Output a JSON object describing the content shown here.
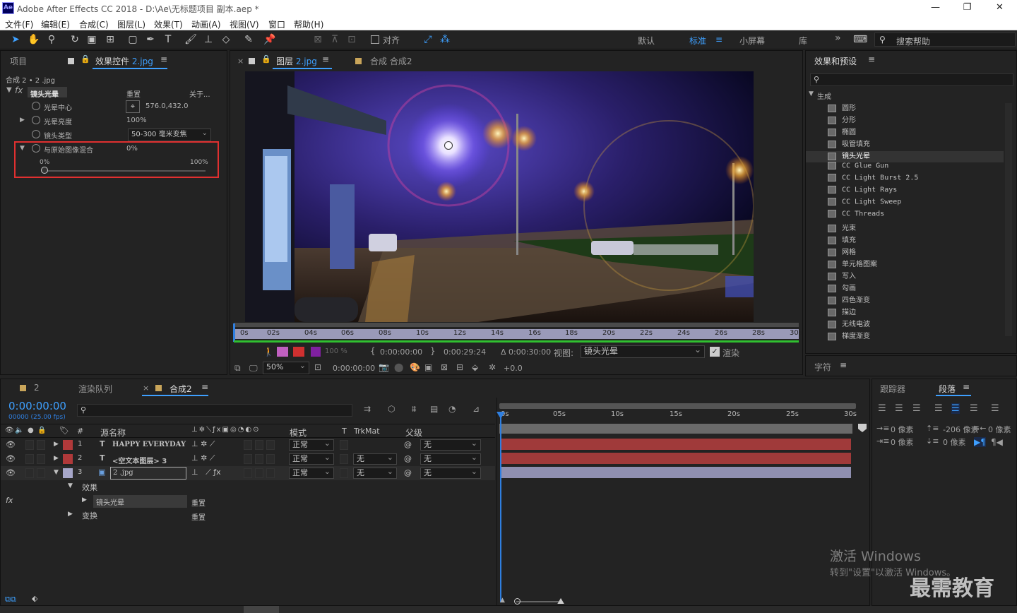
{
  "window": {
    "app_icon": "Ae",
    "title": "Adobe After Effects CC 2018 - D:\\Ae\\无标题项目 副本.aep *"
  },
  "menu": [
    "文件(F)",
    "编辑(E)",
    "合成(C)",
    "图层(L)",
    "效果(T)",
    "动画(A)",
    "视图(V)",
    "窗口",
    "帮助(H)"
  ],
  "toolbar": {
    "snap_label": "对齐",
    "workspaces": [
      "默认",
      "标准",
      "小屏幕",
      "库"
    ],
    "active_workspace": "标准",
    "search_placeholder": "搜索帮助"
  },
  "left_panel": {
    "tab_project": "项目",
    "tab_effect_controls": "效果控件",
    "effect_layer": "2.jpg",
    "breadcrumb": "合成 2 • 2 .jpg",
    "effect_name": "镜头光晕",
    "reset": "重置",
    "about": "关于...",
    "props": [
      {
        "name": "光晕中心",
        "value": "576.0,432.0"
      },
      {
        "name": "光晕亮度",
        "value": "100%"
      },
      {
        "name": "镜头类型",
        "value": "50-300 毫米变焦"
      },
      {
        "name": "与原始图像混合",
        "value": "0%"
      }
    ],
    "slider_min": "0%",
    "slider_max": "100%",
    "slider_value": 0
  },
  "viewer": {
    "tab_layer": "图层",
    "layer_name": "2.jpg",
    "tab_comp": "合成 合成2",
    "ruler": [
      "0s",
      "02s",
      "04s",
      "06s",
      "08s",
      "10s",
      "12s",
      "14s",
      "16s",
      "18s",
      "20s",
      "22s",
      "24s",
      "26s",
      "28s",
      "30s"
    ],
    "opacity": "100 %",
    "in_time": "0:00:00:00",
    "out_time": "0:00:29:24",
    "duration": "Δ 0:00:30:00",
    "view_label": "视图:",
    "view_value": "镜头光晕",
    "render_label": "渲染",
    "zoom": "50%",
    "current_time": "0:00:00:00",
    "exposure": "+0.0"
  },
  "effects_panel": {
    "title": "效果和预设",
    "category": "生成",
    "items": [
      "圆形",
      "分形",
      "椭圆",
      "吸管填充",
      "镜头光晕",
      "CC Glue Gun",
      "CC Light Burst 2.5",
      "CC Light Rays",
      "CC Light Sweep",
      "CC Threads",
      "光束",
      "填充",
      "网格",
      "单元格图案",
      "写入",
      "勾画",
      "四色渐变",
      "描边",
      "无线电波",
      "梯度渐变"
    ],
    "selected": "镜头光晕"
  },
  "char_panel": {
    "title": "字符"
  },
  "para_panel": {
    "tab_tracker": "跟踪器",
    "tab_paragraph": "段落",
    "indent_left": "0 像素",
    "space_before": "-206 像素",
    "indent_right": "0 像素",
    "first_line": "0 像素",
    "space_after": "0 像素"
  },
  "timeline": {
    "tab_comp_number": "2",
    "tab_render_queue": "渲染队列",
    "tab_comp": "合成2",
    "timecode": "0:00:00:00",
    "fps": "00000 (25.00 fps)",
    "columns": {
      "source_name": "源名称",
      "mode": "模式",
      "t": "T",
      "trkmat": "TrkMat",
      "parent": "父级"
    },
    "layers": [
      {
        "num": "1",
        "type": "T",
        "name": "HAPPY EVERYDAY",
        "color": "#b0393a",
        "mode": "正常",
        "trkmat": "",
        "parent": "无"
      },
      {
        "num": "2",
        "type": "T",
        "name": "<空文本图层> 3",
        "color": "#b0393a",
        "mode": "正常",
        "trkmat": "无",
        "parent": "无"
      },
      {
        "num": "3",
        "type": "img",
        "name": "2 .jpg",
        "color": "#a7a7c9",
        "mode": "正常",
        "trkmat": "无",
        "parent": "无"
      }
    ],
    "effects_label": "效果",
    "effect_item": "镜头光晕",
    "reset": "重置",
    "transform_label": "变换",
    "ruler": [
      "0s",
      "05s",
      "10s",
      "15s",
      "20s",
      "25s",
      "30s"
    ]
  },
  "watermark": {
    "activate_title": "激活 Windows",
    "activate_sub": "转到\"设置\"以激活 Windows。",
    "brand": "最需教育"
  },
  "colors": {
    "accent": "#3ea0ff",
    "highlight_box": "#e03030",
    "layer_red": "#b0393a",
    "layer_purple": "#a7a7c9"
  }
}
